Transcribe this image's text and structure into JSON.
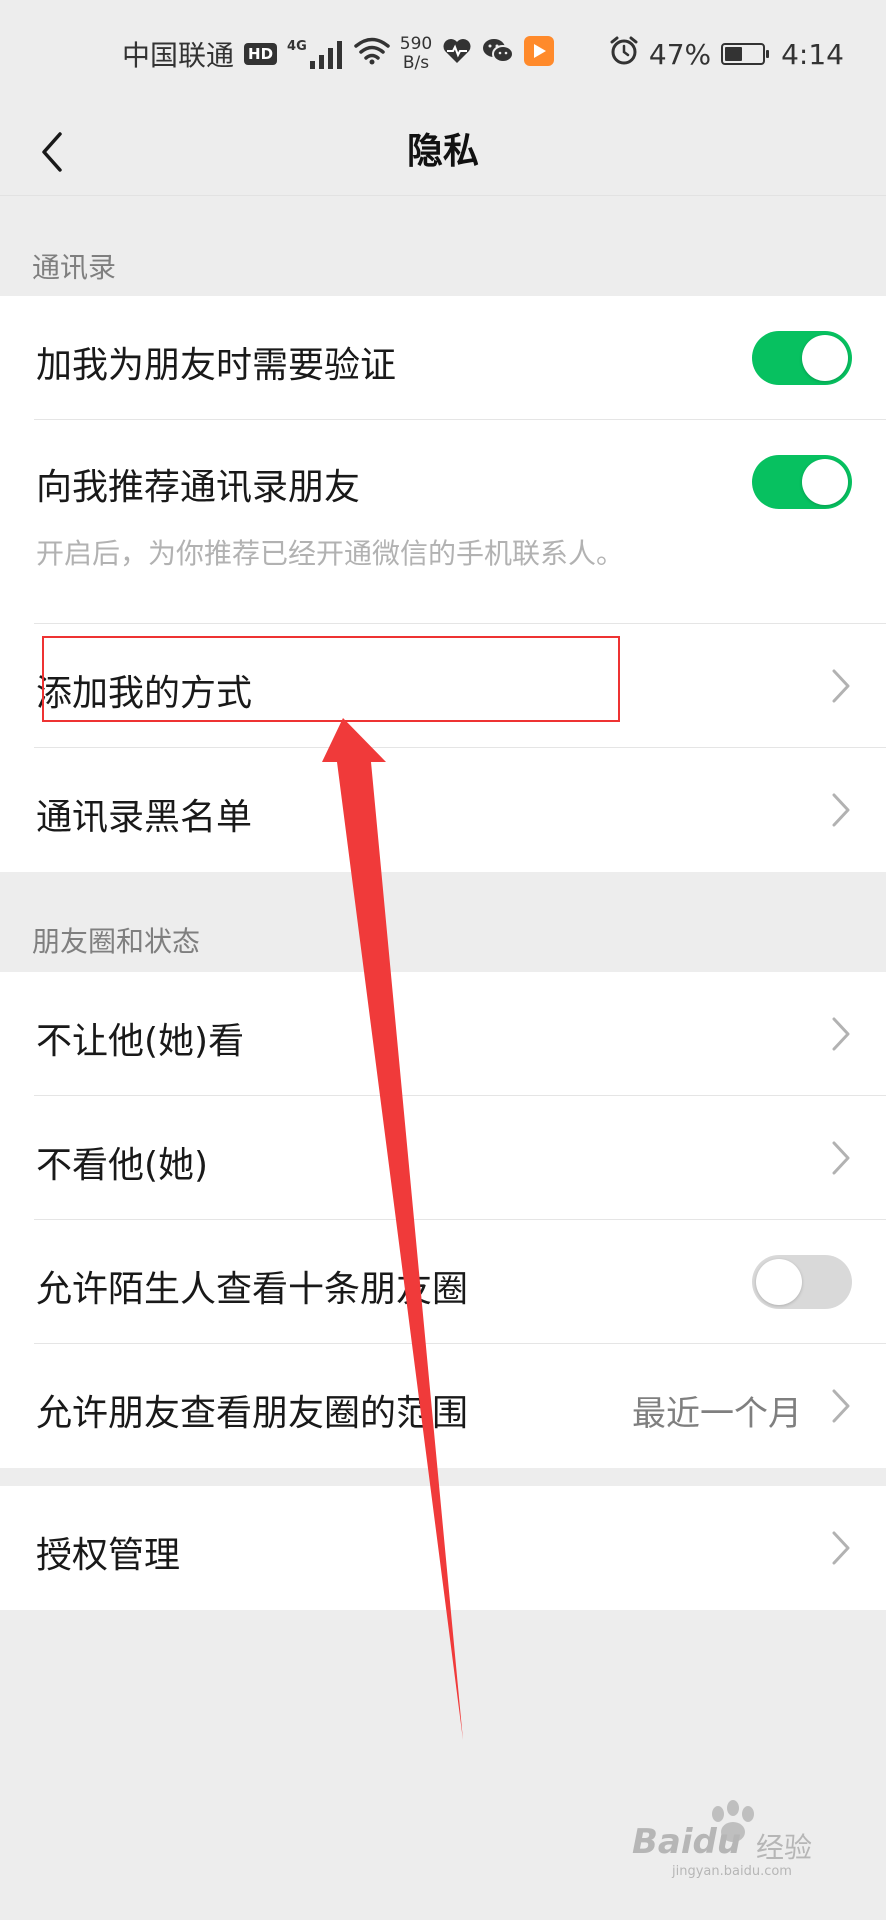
{
  "status_bar": {
    "carrier": "中国联通",
    "hd_badge": "HD",
    "signal_type": "4G",
    "net_speed_value": "590",
    "net_speed_unit": "B/s",
    "battery_percent": "47%",
    "battery_level": 0.47,
    "time": "4:14"
  },
  "nav": {
    "title": "隐私"
  },
  "sections": {
    "contacts": {
      "header": "通讯录",
      "items": [
        {
          "label": "加我为朋友时需要验证",
          "toggle": true
        },
        {
          "label": "向我推荐通讯录朋友",
          "toggle": true,
          "description": "开启后，为你推荐已经开通微信的手机联系人。"
        },
        {
          "label": "添加我的方式"
        },
        {
          "label": "通讯录黑名单"
        }
      ]
    },
    "moments": {
      "header": "朋友圈和状态",
      "items": [
        {
          "label": "不让他(她)看"
        },
        {
          "label": "不看他(她)"
        },
        {
          "label": "允许陌生人查看十条朋友圈",
          "toggle": false
        },
        {
          "label": "允许朋友查看朋友圈的范围",
          "value": "最近一个月"
        }
      ]
    },
    "auth": {
      "items": [
        {
          "label": "授权管理"
        }
      ]
    }
  },
  "watermark": {
    "brand": "Baidu",
    "suffix": "经验",
    "site": "jingyan.baidu.com"
  },
  "colors": {
    "toggle_on": "#07c160",
    "toggle_off": "#d9d9d9",
    "annotation": "#ee3333",
    "background": "#ededed"
  }
}
